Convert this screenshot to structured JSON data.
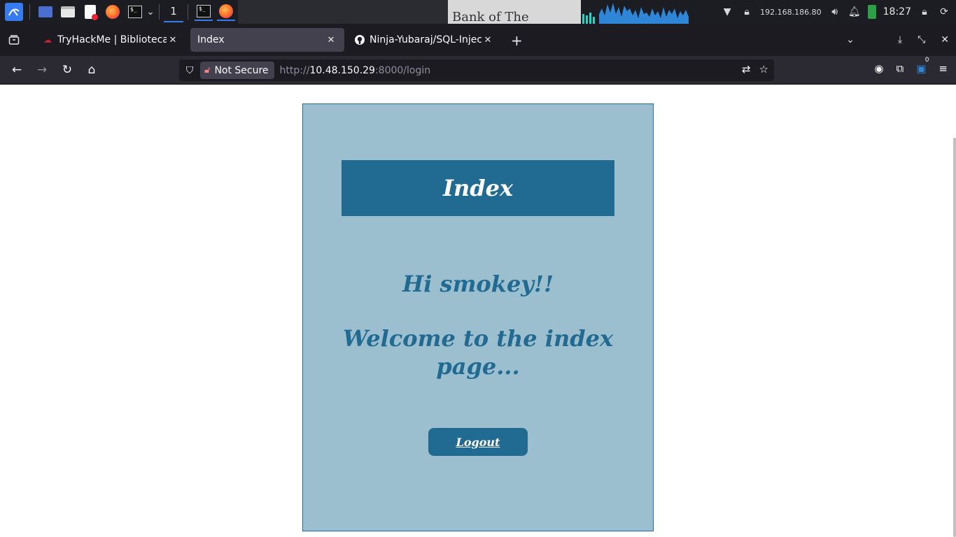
{
  "taskbar": {
    "workspace": "1",
    "ip": "192.168.186.80",
    "clock": "18:27",
    "doc_preview": "Bank of The"
  },
  "tabs": [
    {
      "label": "TryHackMe | Biblioteca",
      "icon": "tryhackme-icon",
      "active": false
    },
    {
      "label": "Index",
      "icon": "",
      "active": true
    },
    {
      "label": "Ninja-Yubaraj/SQL-Injecti",
      "icon": "github-icon",
      "active": false
    }
  ],
  "navbar": {
    "security_label": "Not Secure",
    "url_scheme": "http://",
    "url_host": "10.48.150.29",
    "url_rest": ":8000/login",
    "extensions_badge": "0"
  },
  "page": {
    "title": "Index",
    "greeting": "Hi smokey!!",
    "welcome": "Welcome to the index page...",
    "logout_label": "Logout"
  },
  "colors": {
    "card_bg": "#9bbfcf",
    "accent": "#216a91"
  }
}
